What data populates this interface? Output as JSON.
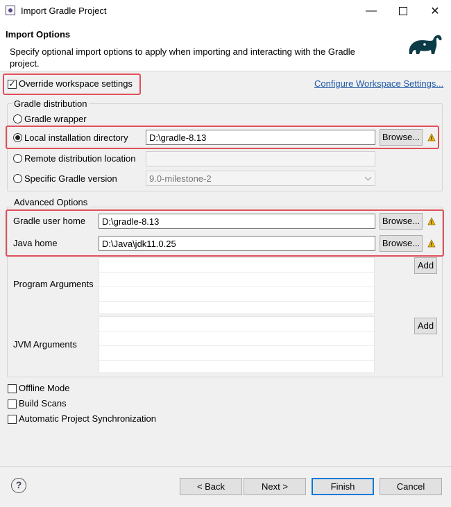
{
  "window": {
    "title": "Import Gradle Project",
    "minimize_icon": "minimize-icon",
    "maximize_icon": "maximize-icon",
    "close_icon": "close-icon"
  },
  "header": {
    "title": "Import Options",
    "description": "Specify optional import options to apply when importing and interacting with the Gradle project.",
    "logo_icon": "gradle-elephant-icon"
  },
  "workspace": {
    "override_label": "Override workspace settings",
    "override_checked": true,
    "configure_link": "Configure Workspace Settings..."
  },
  "distribution": {
    "group_title": "Gradle distribution",
    "options": [
      {
        "label": "Gradle wrapper",
        "selected": false
      },
      {
        "label": "Local installation directory",
        "selected": true
      },
      {
        "label": "Remote distribution location",
        "selected": false
      },
      {
        "label": "Specific Gradle version",
        "selected": false
      }
    ],
    "local_dir_value": "D:\\gradle-8.13",
    "remote_value": "",
    "version_value": "9.0-milestone-2",
    "browse_label": "Browse..."
  },
  "advanced": {
    "group_title": "Advanced Options",
    "gradle_user_home_label": "Gradle user home",
    "gradle_user_home_value": "D:\\gradle-8.13",
    "java_home_label": "Java home",
    "java_home_value": "D:\\Java\\jdk11.0.25",
    "browse_label": "Browse...",
    "program_args_label": "Program Arguments",
    "jvm_args_label": "JVM Arguments",
    "add_label": "Add"
  },
  "options": {
    "offline_label": "Offline Mode",
    "build_scans_label": "Build Scans",
    "auto_sync_label": "Automatic Project Synchronization"
  },
  "footer": {
    "help_icon": "help-icon",
    "back_label": "< Back",
    "next_label": "Next >",
    "finish_label": "Finish",
    "cancel_label": "Cancel"
  },
  "colors": {
    "highlight": "#e0505a",
    "link": "#1f5aa6",
    "warning": "#f2b705"
  }
}
